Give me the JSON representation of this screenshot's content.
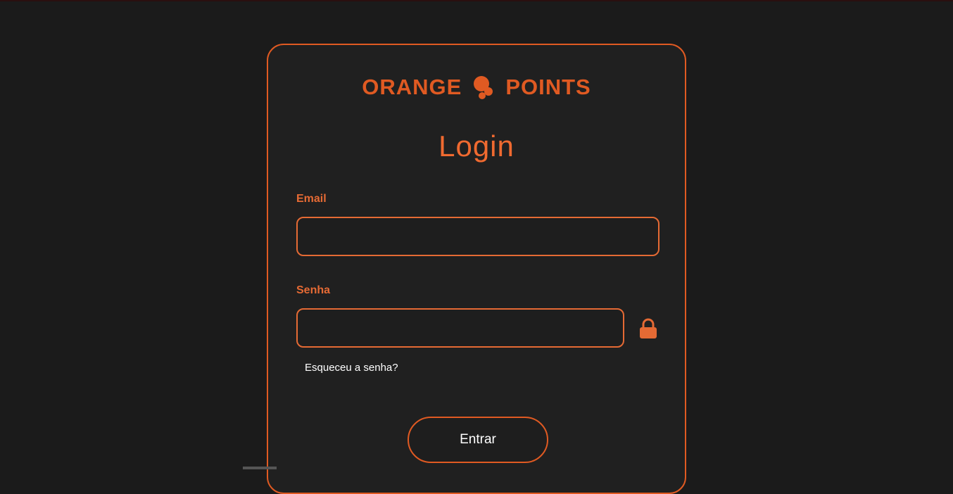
{
  "brand": {
    "name_left": "ORANGE",
    "name_right": "POINTS",
    "logo_icon": "orange-dots-logo-icon",
    "accent_color": "#e05a22"
  },
  "form": {
    "title": "Login",
    "email_label": "Email",
    "email_value": "",
    "password_label": "Senha",
    "password_value": "",
    "password_icon": "lock-icon",
    "forgot_link": "Esqueceu a senha?",
    "submit_label": "Entrar"
  }
}
